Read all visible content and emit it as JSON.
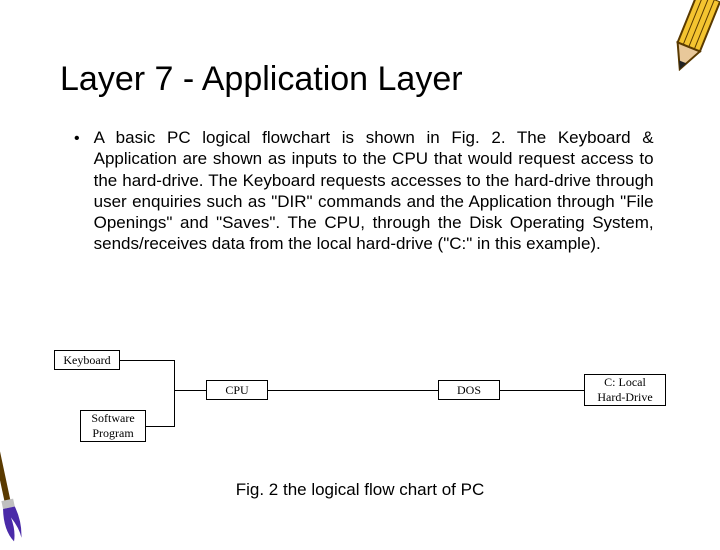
{
  "title": "Layer 7 - Application Layer",
  "bullet_char": "•",
  "body": "A basic PC logical flowchart is shown in Fig. 2. The Keyboard & Application are shown as inputs to the CPU that would request access to the hard-drive. The Keyboard requests accesses to the hard-drive through user enquiries such as \"DIR\" commands and the Application through \"File Openings\" and \"Saves\". The CPU, through the Disk Operating System, sends/receives data from the local hard-drive (\"C:\" in this example).",
  "caption": "Fig. 2 the logical flow chart of PC",
  "diagram": {
    "keyboard": "Keyboard",
    "software": "Software Program",
    "cpu": "CPU",
    "dos": "DOS",
    "drive": "C: Local Hard-Drive"
  }
}
